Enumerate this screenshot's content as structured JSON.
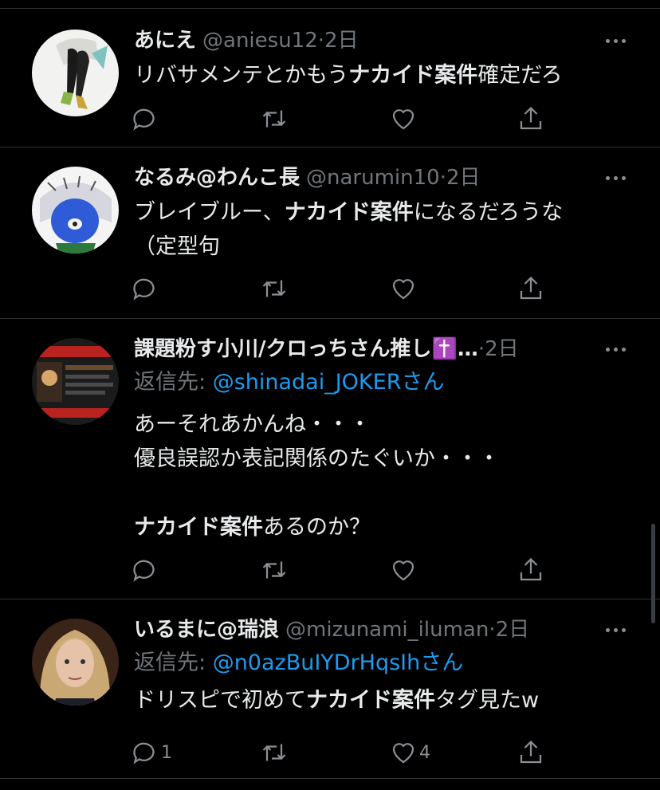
{
  "tweets": [
    {
      "name": "あにえ",
      "handle": "@aniesu12",
      "time": "2日",
      "text_parts": [
        "リバサメンテとかもう",
        "ナカイド案件",
        "確定だろ"
      ],
      "reply_count": "",
      "like_count": ""
    },
    {
      "name": "なるみ@わんこ長",
      "handle": "@narumin10",
      "time": "2日",
      "text_parts": [
        "ブレイブルー、",
        "ナカイド案件",
        "になるだろうな\n（定型句"
      ],
      "reply_count": "",
      "like_count": ""
    },
    {
      "name": "課題粉す小川/クロっちさん推し✝️…",
      "handle": "",
      "time": "2日",
      "reply_prefix": "返信先: ",
      "reply_mention": "@shinadai_JOKERさん",
      "text_parts": [
        "あーそれあかんね・・・\n優良誤認か表記関係のたぐいか・・・\n\n",
        "ナカイド案件",
        "あるのか？"
      ],
      "reply_count": "",
      "like_count": ""
    },
    {
      "name": "いるまに@瑞浪",
      "handle": "@mizunami_iluman",
      "time": "2日",
      "reply_prefix": "返信先: ",
      "reply_mention": "@n0azBuIYDrHqsIhさん",
      "text_parts": [
        "ドリスピで初めて",
        "ナカイド案件",
        "タグ見たw"
      ],
      "reply_count": "1",
      "like_count": "4"
    }
  ],
  "separator": "·",
  "icons": {
    "reply": "reply-icon",
    "retweet": "retweet-icon",
    "like": "heart-icon",
    "share": "share-icon",
    "more": "more-icon"
  },
  "colors": {
    "background": "#000000",
    "text": "#e7e9ea",
    "muted": "#71767b",
    "accent": "#1d9bf0",
    "divider": "#2f3336"
  }
}
